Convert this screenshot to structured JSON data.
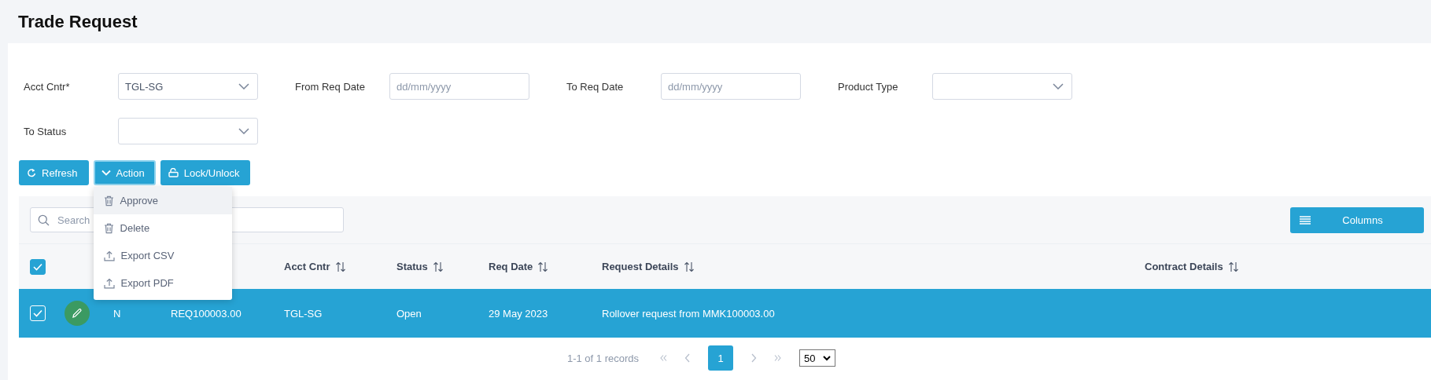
{
  "page": {
    "title": "Trade Request"
  },
  "filters": [
    {
      "label": "Acct Cntr*",
      "kind": "select",
      "value": "TGL-SG"
    },
    {
      "label": "From Req Date",
      "kind": "date",
      "placeholder": "dd/mm/yyyy"
    },
    {
      "label": "To Req Date",
      "kind": "date",
      "placeholder": "dd/mm/yyyy"
    },
    {
      "label": "Product Type",
      "kind": "select"
    },
    {
      "label": "To Status",
      "kind": "select"
    }
  ],
  "buttons": [
    {
      "label": "Refresh",
      "kind": "refresh",
      "expanded": false
    },
    {
      "label": "Action",
      "kind": "caret",
      "expanded": true
    },
    {
      "label": "Lock/Unlock",
      "kind": "lock",
      "expanded": false
    }
  ],
  "action_menu": [
    {
      "label": "Approve",
      "kind": "trash",
      "selected": true
    },
    {
      "label": "Delete",
      "kind": "trash",
      "selected": false
    },
    {
      "label": "Export CSV",
      "kind": "upload",
      "selected": false
    },
    {
      "label": "Export PDF",
      "kind": "upload",
      "selected": false
    }
  ],
  "search": {
    "placeholder": "Search"
  },
  "columns_button": {
    "label": "Columns"
  },
  "table": {
    "all_checked": true,
    "columns": [
      {
        "label": "Acct Cntr"
      },
      {
        "label": "Status"
      },
      {
        "label": "Req Date"
      },
      {
        "label": "Request Details"
      },
      {
        "label": "Contract Details"
      }
    ],
    "rows": [
      {
        "selected": true,
        "checked": true,
        "flag": "N",
        "request_no": "REQ100003.00",
        "cells": [
          "TGL-SG",
          "Open",
          "29 May 2023",
          "Rollover request from MMK100003.00"
        ]
      }
    ]
  },
  "pagination": {
    "summary": "1-1 of 1 records",
    "pages": [
      {
        "label": "1",
        "selected": true
      }
    ],
    "page_size": "50"
  }
}
